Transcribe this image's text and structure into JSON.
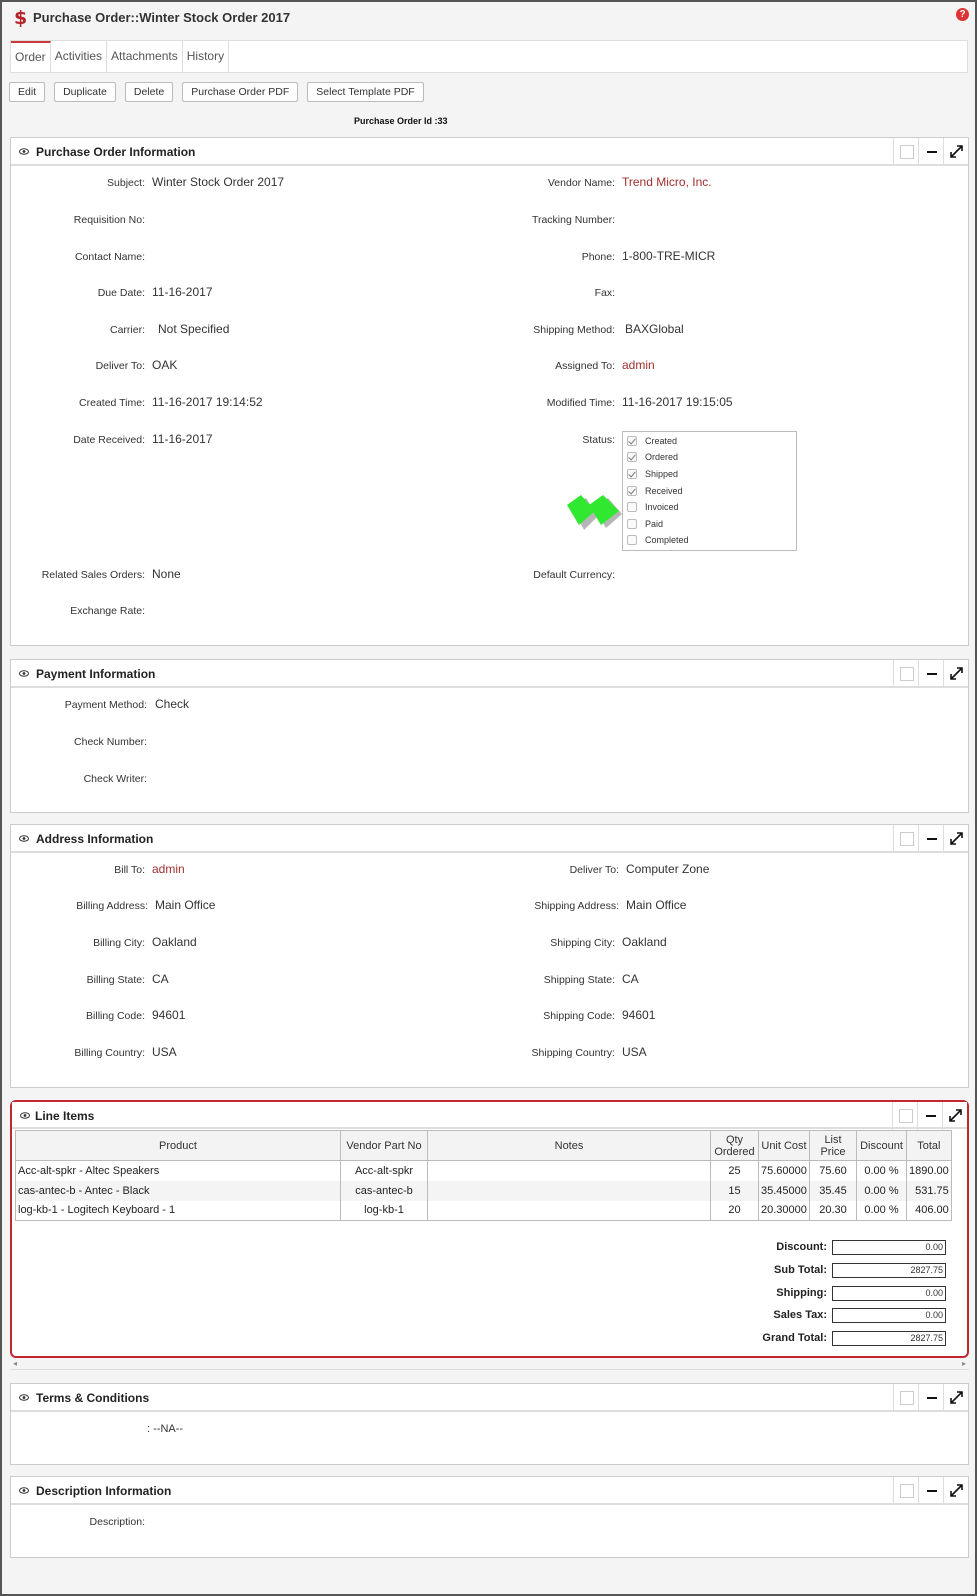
{
  "window": {
    "title": "Purchase Order::Winter Stock Order 2017"
  },
  "tabs": [
    {
      "label": "Order",
      "active": true
    },
    {
      "label": "Activities",
      "active": false
    },
    {
      "label": "Attachments",
      "active": false
    },
    {
      "label": "History",
      "active": false
    }
  ],
  "toolbar": {
    "edit": "Edit",
    "duplicate": "Duplicate",
    "delete": "Delete",
    "po_pdf": "Purchase Order PDF",
    "template_pdf": "Select Template PDF"
  },
  "purchase_order_id": "Purchase Order Id :33",
  "po_info": {
    "title": "Purchase Order Information",
    "subject_label": "Subject:",
    "subject": "Winter Stock Order 2017",
    "vendor_label": "Vendor Name:",
    "vendor": "Trend Micro, Inc.",
    "requisition_label": "Requisition No:",
    "tracking_label": "Tracking Number:",
    "contact_label": "Contact Name:",
    "phone_label": "Phone:",
    "phone": "1-800-TRE-MICR",
    "due_label": "Due Date:",
    "due": "11-16-2017",
    "fax_label": "Fax:",
    "carrier_label": "Carrier:",
    "carrier": "Not Specified",
    "shipping_method_label": "Shipping Method:",
    "shipping_method": "BAXGlobal",
    "deliver_label": "Deliver To:",
    "deliver": "OAK",
    "assigned_label": "Assigned To:",
    "assigned": "admin",
    "created_label": "Created Time:",
    "created": "11-16-2017 19:14:52",
    "modified_label": "Modified Time:",
    "modified": "11-16-2017 19:15:05",
    "received_label": "Date Received:",
    "received": "11-16-2017",
    "status_label": "Status:",
    "status": [
      {
        "label": "Created",
        "checked": true
      },
      {
        "label": "Ordered",
        "checked": true
      },
      {
        "label": "Shipped",
        "checked": true
      },
      {
        "label": "Received",
        "checked": true
      },
      {
        "label": "Invoiced",
        "checked": false
      },
      {
        "label": "Paid",
        "checked": false
      },
      {
        "label": "Completed",
        "checked": false
      }
    ],
    "related_label": "Related Sales Orders:",
    "related": "None",
    "currency_label": "Default Currency:",
    "exchange_label": "Exchange Rate:"
  },
  "payment": {
    "title": "Payment Information",
    "method_label": "Payment Method:",
    "method": "Check",
    "check_number_label": "Check Number:",
    "check_writer_label": "Check Writer:"
  },
  "address": {
    "title": "Address Information",
    "bill_to_label": "Bill To:",
    "bill_to": "admin",
    "deliver_to_label": "Deliver To:",
    "deliver_to": "Computer Zone",
    "billing_address_label": "Billing Address:",
    "billing_address": "Main Office",
    "shipping_address_label": "Shipping Address:",
    "shipping_address": "Main Office",
    "billing_city_label": "Billing City:",
    "billing_city": "Oakland",
    "shipping_city_label": "Shipping City:",
    "shipping_city": "Oakland",
    "billing_state_label": "Billing State:",
    "billing_state": "CA",
    "shipping_state_label": "Shipping State:",
    "shipping_state": "CA",
    "billing_code_label": "Billing Code:",
    "billing_code": "94601",
    "shipping_code_label": "Shipping Code:",
    "shipping_code": "94601",
    "billing_country_label": "Billing Country:",
    "billing_country": "USA",
    "shipping_country_label": "Shipping Country:",
    "shipping_country": "USA"
  },
  "line_items": {
    "title": "Line Items",
    "columns": [
      "Product",
      "Vendor Part No",
      "Notes",
      "Qty Ordered",
      "Unit Cost",
      "List Price",
      "Discount",
      "Total"
    ],
    "rows": [
      {
        "product": "Acc-alt-spkr - Altec Speakers",
        "part": "Acc-alt-spkr",
        "notes": "",
        "qty": "25",
        "unit": "75.60000",
        "list": "75.60",
        "discount": "0.00 %",
        "total": "1890.00"
      },
      {
        "product": "cas-antec-b - Antec - Black",
        "part": "cas-antec-b",
        "notes": "",
        "qty": "15",
        "unit": "35.45000",
        "list": "35.45",
        "discount": "0.00 %",
        "total": "531.75"
      },
      {
        "product": "log-kb-1 - Logitech Keyboard - 1",
        "part": "log-kb-1",
        "notes": "",
        "qty": "20",
        "unit": "20.30000",
        "list": "20.30",
        "discount": "0.00 %",
        "total": "406.00"
      }
    ],
    "totals": {
      "discount_label": "Discount:",
      "discount": "0.00",
      "subtotal_label": "Sub Total:",
      "subtotal": "2827.75",
      "shipping_label": "Shipping:",
      "shipping": "0.00",
      "tax_label": "Sales Tax:",
      "tax": "0.00",
      "grand_label": "Grand Total:",
      "grand": "2827.75"
    }
  },
  "terms": {
    "title": "Terms & Conditions",
    "value": ": --NA--"
  },
  "description": {
    "title": "Description Information",
    "label": "Description:"
  },
  "colors": {
    "accent": "#c7393f",
    "link": "#a0302f",
    "highlight_border": "#c0282e",
    "arrow": "#33ee33"
  },
  "icons": [
    "dollar-icon",
    "help-icon",
    "eye-icon",
    "minimize-icon",
    "expand-icon",
    "green-arrow-icon"
  ]
}
